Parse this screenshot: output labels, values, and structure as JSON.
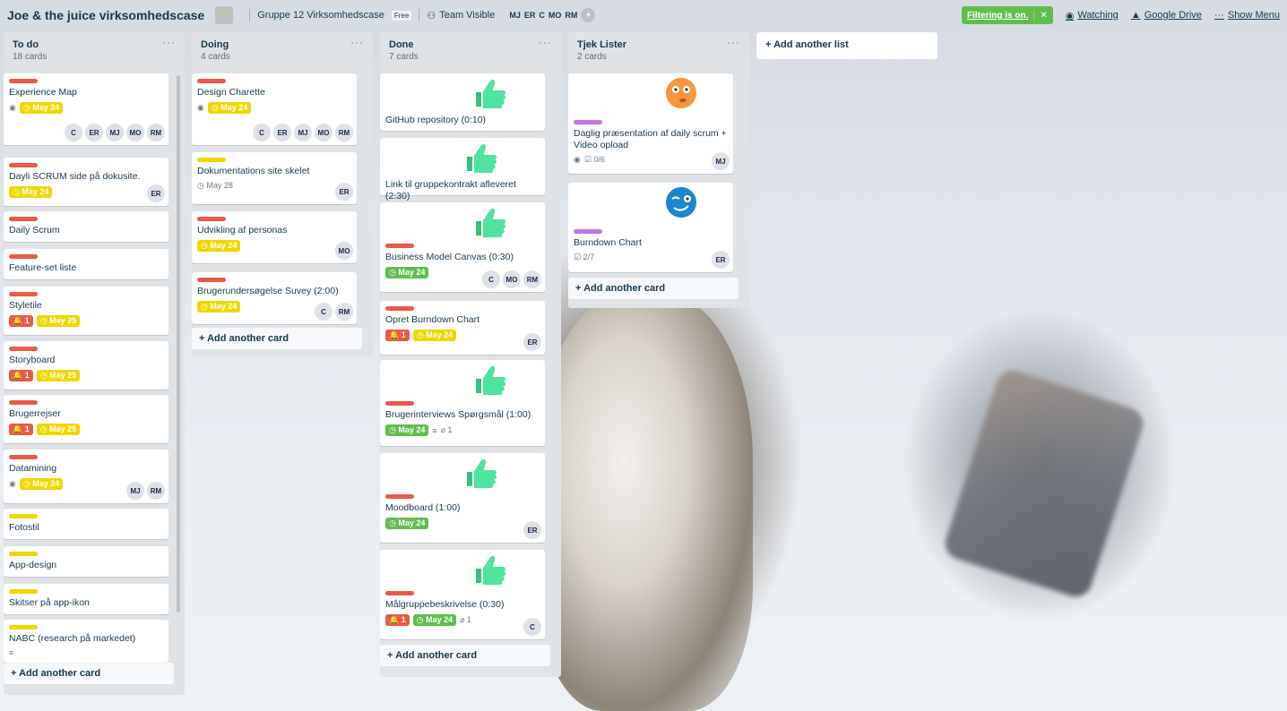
{
  "header": {
    "board_title": "Joe & the juice virksomhedscase",
    "star": "☆",
    "team": "Gruppe 12 Virksomhedscase",
    "team_badge": "Free",
    "visibility": "Team Visible",
    "members": [
      "MJ",
      "ER",
      "C",
      "MO",
      "RM"
    ],
    "add_member": "+",
    "filter_label": "Filtering is on.",
    "filter_close": "✕",
    "watching": "Watching",
    "google_drive": "Google Drive",
    "show_menu": "Show Menu"
  },
  "lists": [
    {
      "title": "To do",
      "count": "18 cards",
      "menu": "···",
      "add_card": "+ Add another card",
      "cards": [
        {
          "title": "Experience Map",
          "label": "red",
          "due": "May 24",
          "due_style": "yellow",
          "watch": true,
          "members": [
            "C",
            "ER",
            "MJ",
            "MO",
            "RM"
          ]
        },
        {
          "title": "Dayli SCRUM side på dokusite.",
          "label": "red",
          "due": "May 24",
          "due_style": "yellow",
          "members": [
            "ER"
          ]
        },
        {
          "title": "Daily Scrum",
          "label": "red"
        },
        {
          "title": "Feature-set liste",
          "label": "red"
        },
        {
          "title": "Styletile",
          "label": "red",
          "alarm": "1",
          "due": "May 25",
          "due_style": "yellow"
        },
        {
          "title": "Storyboard",
          "label": "red",
          "alarm": "1",
          "due": "May 25",
          "due_style": "yellow"
        },
        {
          "title": "Brugerrejser",
          "label": "red",
          "alarm": "1",
          "due": "May 25",
          "due_style": "yellow"
        },
        {
          "title": "Datamining",
          "label": "red",
          "due": "May 24",
          "due_style": "yellow",
          "watch": true,
          "members": [
            "MJ",
            "RM"
          ]
        },
        {
          "title": "Fotostil",
          "label": "yellow"
        },
        {
          "title": "App-design",
          "label": "yellow"
        },
        {
          "title": "Skitser på app-ikon",
          "label": "yellow"
        },
        {
          "title": "NABC (research på markedet)",
          "label": "yellow",
          "description": true
        }
      ]
    },
    {
      "title": "Doing",
      "count": "4 cards",
      "menu": "···",
      "add_card": "+ Add another card",
      "cards": [
        {
          "title": "Design Charette",
          "label": "red",
          "due": "May 24",
          "due_style": "yellow",
          "watch": true,
          "members": [
            "C",
            "ER",
            "MJ",
            "MO",
            "RM"
          ]
        },
        {
          "title": "Dokumentations site skelet",
          "label": "yellow",
          "due": "May 28",
          "due_style": "plain",
          "members": [
            "ER"
          ]
        },
        {
          "title": "Udvikling af personas",
          "label": "red",
          "due": "May 24",
          "due_style": "yellow",
          "members": [
            "MO"
          ]
        },
        {
          "title": "Brugerundersøgelse Suvey (2:00)",
          "label": "red",
          "due": "May 24",
          "due_style": "yellow",
          "members": [
            "C",
            "RM"
          ]
        }
      ]
    },
    {
      "title": "Done",
      "count": "7 cards",
      "menu": "···",
      "add_card": "+ Add another card",
      "cards": [
        {
          "title": "GitHub repository (0:10)",
          "sticker": "thumbsup"
        },
        {
          "title": "Link til gruppekontrakt afleveret (2:30)",
          "sticker": "thumbsup"
        },
        {
          "title": "Business Model Canvas (0:30)",
          "sticker": "thumbsup",
          "label": "red",
          "due": "May 24",
          "due_style": "green",
          "members": [
            "C",
            "MO",
            "RM"
          ]
        },
        {
          "title": "Opret Burndown Chart",
          "label": "red",
          "alarm": "1",
          "due": "May 24",
          "due_style": "yellow",
          "members": [
            "ER"
          ]
        },
        {
          "title": "Brugerinterviews Spørgsmål (1:00)",
          "sticker": "thumbsup",
          "label": "red",
          "due": "May 24",
          "due_style": "green",
          "description": true,
          "attachments": "1"
        },
        {
          "title": "Moodboard (1:00)",
          "sticker": "thumbsup",
          "label": "red",
          "due": "May 24",
          "due_style": "green",
          "members": [
            "ER"
          ]
        },
        {
          "title": "Målgruppebeskrivelse (0:30)",
          "sticker": "thumbsup",
          "label": "red",
          "alarm": "1",
          "due": "May 24",
          "due_style": "green",
          "attachments": "1",
          "members": [
            "C"
          ]
        }
      ]
    },
    {
      "title": "Tjek Lister",
      "count": "2 cards",
      "menu": "···",
      "add_card": "+ Add another card",
      "cards": [
        {
          "title": "Daglig præsentation af daily scrum + Video opload",
          "sticker": "surprised",
          "label": "purple",
          "watch": true,
          "checklist": "0/6",
          "members": [
            "MJ"
          ]
        },
        {
          "title": "Burndown Chart",
          "sticker": "wink",
          "label": "purple",
          "checklist": "2/7",
          "members": [
            "ER"
          ]
        }
      ]
    }
  ],
  "add_list": "+ Add another list",
  "colors": {
    "red": "#eb5a46",
    "yellow": "#f2d600",
    "green": "#61bd4f",
    "purple": "#c377e0"
  }
}
